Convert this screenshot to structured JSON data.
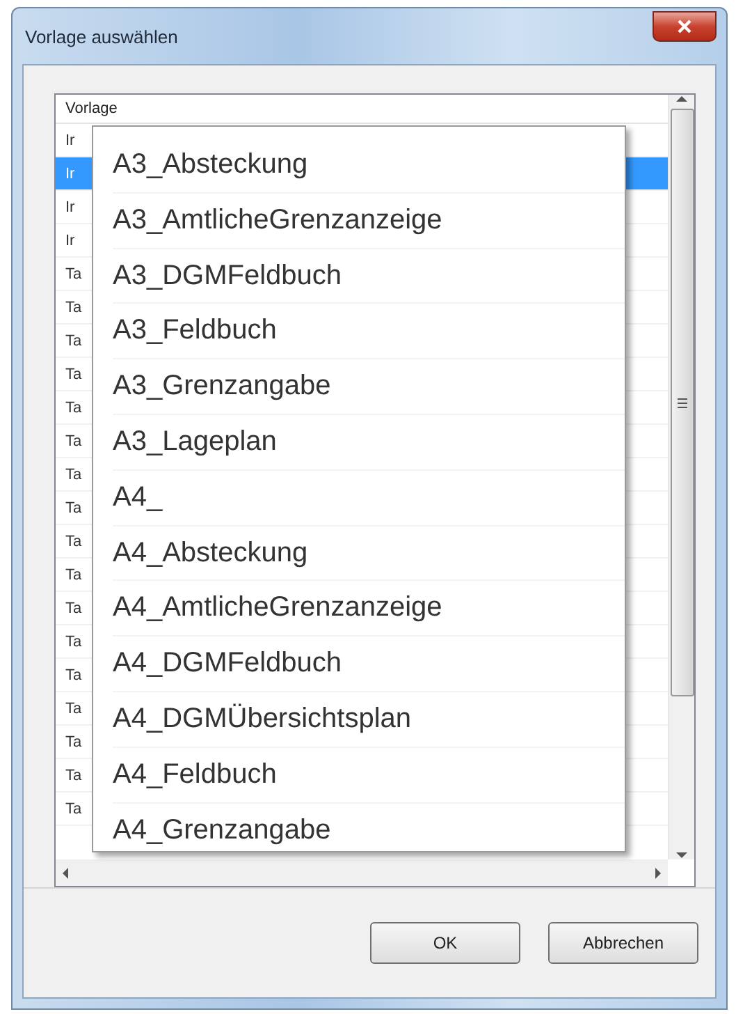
{
  "window": {
    "title": "Vorlage auswählen"
  },
  "list": {
    "header": "Vorlage",
    "rows": [
      {
        "text": "Ir",
        "selected": false
      },
      {
        "text": "Ir",
        "selected": true
      },
      {
        "text": "Ir",
        "selected": false
      },
      {
        "text": "Ir",
        "selected": false
      },
      {
        "text": "Ta",
        "selected": false
      },
      {
        "text": "Ta",
        "selected": false
      },
      {
        "text": "Ta",
        "selected": false
      },
      {
        "text": "Ta",
        "selected": false
      },
      {
        "text": "Ta",
        "selected": false
      },
      {
        "text": "Ta",
        "selected": false
      },
      {
        "text": "Ta",
        "selected": false
      },
      {
        "text": "Ta",
        "selected": false
      },
      {
        "text": "Ta",
        "selected": false
      },
      {
        "text": "Ta",
        "selected": false
      },
      {
        "text": "Ta",
        "selected": false
      },
      {
        "text": "Ta",
        "selected": false
      },
      {
        "text": "Ta",
        "selected": false
      },
      {
        "text": "Ta",
        "selected": false
      },
      {
        "text": "Ta",
        "selected": false
      },
      {
        "text": "Ta",
        "selected": false
      },
      {
        "text": "Ta",
        "selected": false
      }
    ]
  },
  "popup": {
    "items": [
      "A3_Absteckung",
      "A3_AmtlicheGrenzanzeige",
      "A3_DGMFeldbuch",
      "A3_Feldbuch",
      "A3_Grenzangabe",
      "A3_Lageplan",
      "A4_",
      "A4_Absteckung",
      "A4_AmtlicheGrenzanzeige",
      "A4_DGMFeldbuch",
      "A4_DGMÜbersichtsplan",
      "A4_Feldbuch",
      "A4_Grenzangabe"
    ]
  },
  "buttons": [
    "OK",
    "Abbrechen"
  ]
}
